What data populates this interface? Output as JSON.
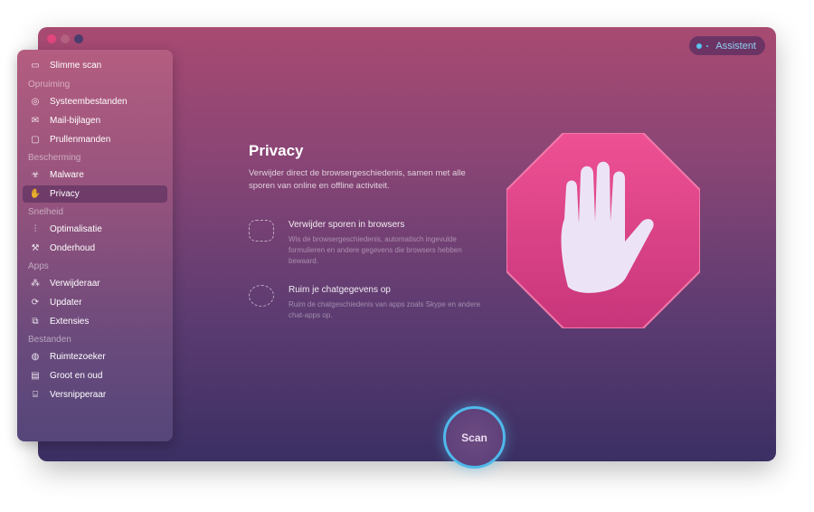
{
  "window": {
    "controls": [
      "close",
      "minimize",
      "zoom"
    ],
    "assistant_label": "Assistent"
  },
  "sidebar": {
    "top": {
      "label": "Slimme scan",
      "icon": "monitor-icon"
    },
    "sections": [
      {
        "title": "Opruiming",
        "items": [
          {
            "label": "Systeembestanden",
            "icon": "disk-icon"
          },
          {
            "label": "Mail-bijlagen",
            "icon": "mail-icon"
          },
          {
            "label": "Prullenmanden",
            "icon": "trash-icon"
          }
        ]
      },
      {
        "title": "Bescherming",
        "items": [
          {
            "label": "Malware",
            "icon": "biohazard-icon"
          },
          {
            "label": "Privacy",
            "icon": "hand-icon",
            "active": true
          }
        ]
      },
      {
        "title": "Snelheid",
        "items": [
          {
            "label": "Optimalisatie",
            "icon": "sliders-icon"
          },
          {
            "label": "Onderhoud",
            "icon": "wrench-icon"
          }
        ]
      },
      {
        "title": "Apps",
        "items": [
          {
            "label": "Verwijderaar",
            "icon": "uninstall-icon"
          },
          {
            "label": "Updater",
            "icon": "update-icon"
          },
          {
            "label": "Extensies",
            "icon": "puzzle-icon"
          }
        ]
      },
      {
        "title": "Bestanden",
        "items": [
          {
            "label": "Ruimtezoeker",
            "icon": "planet-icon"
          },
          {
            "label": "Groot en oud",
            "icon": "folder-icon"
          },
          {
            "label": "Versnipperaar",
            "icon": "shredder-icon"
          }
        ]
      }
    ]
  },
  "main": {
    "title": "Privacy",
    "description": "Verwijder direct de browsergeschiedenis, samen met alle sporen van online en offline activiteit.",
    "features": [
      {
        "icon": "mask-icon",
        "title": "Verwijder sporen in browsers",
        "text": "Wis de browsergeschiedenis, automatisch ingevulde formulieren en andere gegevens die browsers hebben bewaard."
      },
      {
        "icon": "chat-bubble-icon",
        "title": "Ruim je chatgegevens op",
        "text": "Ruim de chatgeschiedenis van apps zoals Skype en andere chat-apps op."
      }
    ],
    "scan_label": "Scan"
  },
  "colors": {
    "accent": "#4fb9ea",
    "octagon": "#e0468a"
  }
}
